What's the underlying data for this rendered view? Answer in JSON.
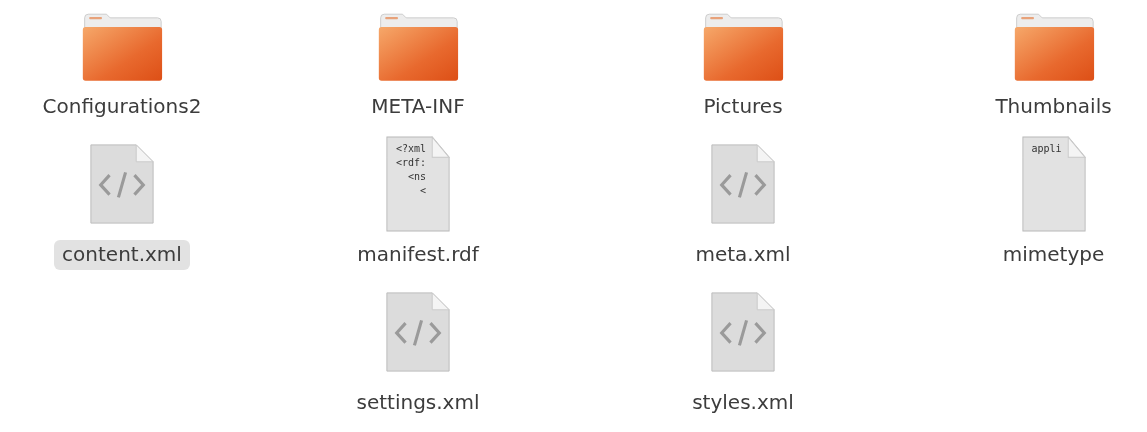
{
  "items": [
    {
      "name": "Configurations2",
      "kind": "folder",
      "selected": false
    },
    {
      "name": "META-INF",
      "kind": "folder",
      "selected": false
    },
    {
      "name": "Pictures",
      "kind": "folder",
      "selected": false
    },
    {
      "name": "Thumbnails",
      "kind": "folder",
      "selected": false
    },
    {
      "name": "content.xml",
      "kind": "code",
      "selected": true
    },
    {
      "name": "manifest.rdf",
      "kind": "text",
      "selected": false,
      "preview": [
        "<?xml",
        "<rdf:",
        "  <ns",
        "    <"
      ]
    },
    {
      "name": "meta.xml",
      "kind": "code",
      "selected": false
    },
    {
      "name": "mimetype",
      "kind": "text",
      "selected": false,
      "preview": [
        "appli"
      ]
    },
    {
      "name": "settings.xml",
      "kind": "code",
      "selected": false
    },
    {
      "name": "styles.xml",
      "kind": "code",
      "selected": false
    }
  ]
}
